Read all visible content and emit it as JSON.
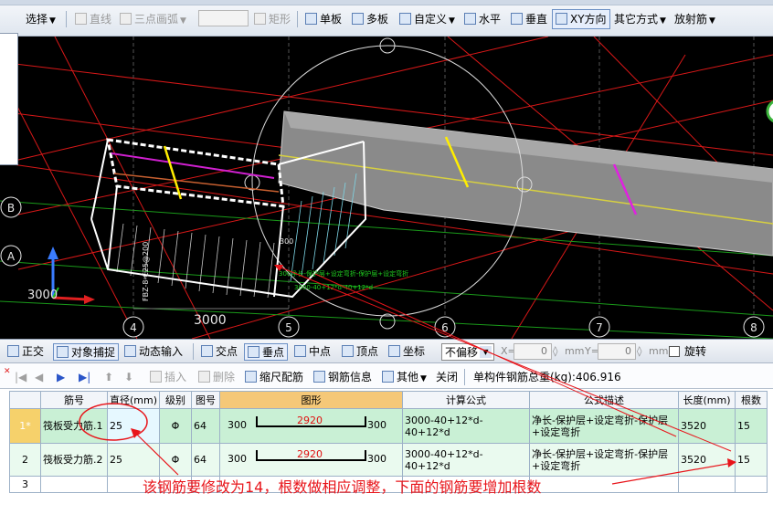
{
  "toolbar": {
    "select": "选择",
    "line": "直线",
    "arc": "三点画弧",
    "rect": "矩形",
    "single_board": "单板",
    "multi_board": "多板",
    "custom": "自定义",
    "horizontal": "水平",
    "vertical": "垂直",
    "xy_dir": "XY方向",
    "other_ways": "其它方式",
    "radial": "放射筋"
  },
  "canvas": {
    "axis_labels": [
      "B",
      "A",
      "4",
      "5",
      "6",
      "7",
      "8"
    ],
    "dim_3000_a": "3000",
    "dim_3000_b": "3000",
    "label_300": "300",
    "vertical_label": "FBZ-8-C25@200",
    "green_label_1": "300净长-保护层+设定弯折-保护层+设定弯折",
    "green_label_2": "3000-40+12*d-40+12*d"
  },
  "snap": {
    "ortho": "正交",
    "object_snap": "对象捕捉",
    "dynamic_input": "动态输入",
    "intersection": "交点",
    "perpendicular": "垂点",
    "midpoint": "中点",
    "vertex": "顶点",
    "coordinate": "坐标",
    "offset_mode": "不偏移",
    "x_label": "X=",
    "x_value": "0",
    "y_label": "Y=",
    "y_value": "0",
    "unit_mm": "mm",
    "rotate": "旋转"
  },
  "rebar_toolbar": {
    "insert": "插入",
    "delete": "删除",
    "scale_rebar": "缩尺配筋",
    "rebar_info": "钢筋信息",
    "other": "其他",
    "close": "关闭",
    "total_weight_label": "单构件钢筋总重(kg):",
    "total_weight_value": "406.916"
  },
  "table": {
    "headers": [
      "筋号",
      "直径(mm)",
      "级别",
      "图号",
      "图形",
      "计算公式",
      "公式描述",
      "长度(mm)",
      "根数"
    ],
    "rows": [
      {
        "num": "1*",
        "name": "筏板受力筋.1",
        "diameter": "25",
        "grade": "Φ",
        "fig": "64",
        "shape_left": "300",
        "shape_mid": "2920",
        "shape_right": "300",
        "formula": "3000-40+12*d-40+12*d",
        "desc": "净长-保护层+设定弯折-保护层+设定弯折",
        "length": "3520",
        "count": "15"
      },
      {
        "num": "2",
        "name": "筏板受力筋.2",
        "diameter": "25",
        "grade": "Φ",
        "fig": "64",
        "shape_left": "300",
        "shape_mid": "2920",
        "shape_right": "300",
        "formula": "3000-40+12*d-40+12*d",
        "desc": "净长-保护层+设定弯折-保护层+设定弯折",
        "length": "3520",
        "count": "15"
      },
      {
        "num": "3",
        "name": "",
        "diameter": "",
        "grade": "",
        "fig": "",
        "shape_left": "",
        "shape_mid": "",
        "shape_right": "",
        "formula": "",
        "desc": "",
        "length": "",
        "count": ""
      }
    ]
  },
  "annotation": {
    "note": "该钢筋要修改为14，根数做相应调整，下面的钢筋要增加根数"
  },
  "colors": {
    "annotation_red": "#e8141a",
    "canvas_bg": "#000000",
    "row_selected": "#c9f0d5",
    "shape_header": "#f5c878"
  }
}
